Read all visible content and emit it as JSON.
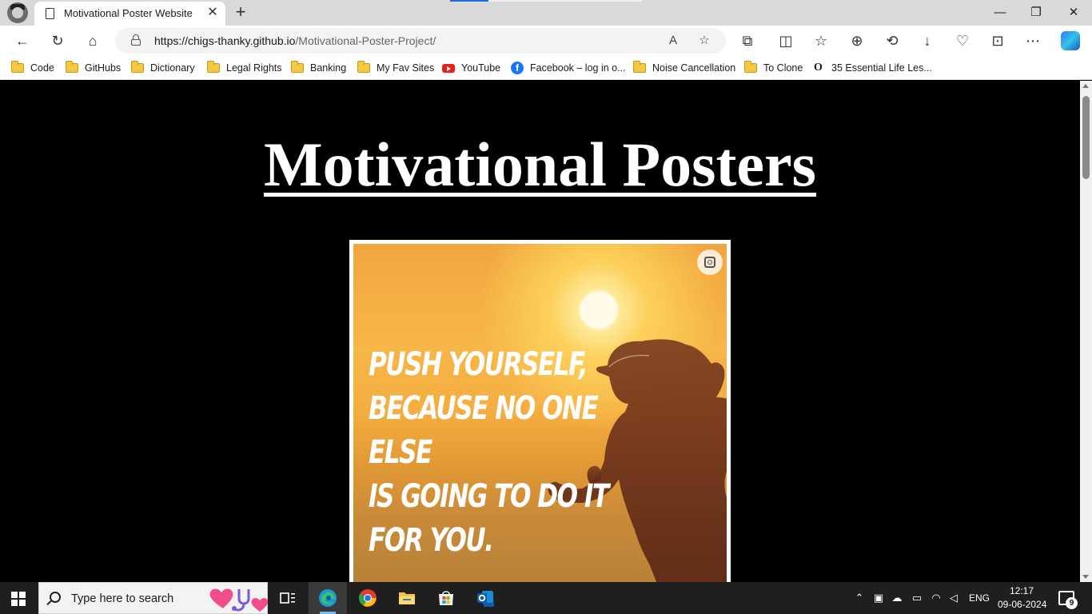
{
  "browser": {
    "tab_title": "Motivational Poster Website",
    "tab_close": "✕",
    "new_tab": "+",
    "url_host": "https://chigs-thanky.github.io",
    "url_path": "/Motivational-Poster-Project/",
    "window": {
      "minimize": "—",
      "restore": "❐",
      "close": "✕"
    }
  },
  "bookmarks": [
    {
      "label": "Code",
      "icon": "folder-icon"
    },
    {
      "label": "GitHubs",
      "icon": "folder-icon"
    },
    {
      "label": "Dictionary",
      "icon": "folder-icon"
    },
    {
      "label": "Legal Rights",
      "icon": "folder-icon"
    },
    {
      "label": "Banking",
      "icon": "folder-icon"
    },
    {
      "label": "My Fav Sites",
      "icon": "folder-icon"
    },
    {
      "label": "YouTube",
      "icon": "youtube-icon"
    },
    {
      "label": "Facebook – log in o...",
      "icon": "facebook-icon"
    },
    {
      "label": "Noise Cancellation",
      "icon": "folder-icon"
    },
    {
      "label": "To Clone",
      "icon": "folder-icon"
    },
    {
      "label": "35 Essential Life Les...",
      "icon": "site-o-icon"
    }
  ],
  "page": {
    "title": "Motivational Posters",
    "poster": {
      "line1": "PUSH YOURSELF,",
      "line2": "BECAUSE NO ONE ELSE",
      "line3": "IS GOING TO DO IT",
      "line4": "FOR YOU."
    }
  },
  "taskbar": {
    "search_placeholder": "Type here to search",
    "language": "ENG",
    "time": "12:17",
    "date": "09-06-2024",
    "notification_count": "9"
  },
  "colors": {
    "page_background": "#000000",
    "title_color": "#ffffff",
    "poster_sky": "#f4ad40",
    "taskbar": "#1f1f1f"
  }
}
